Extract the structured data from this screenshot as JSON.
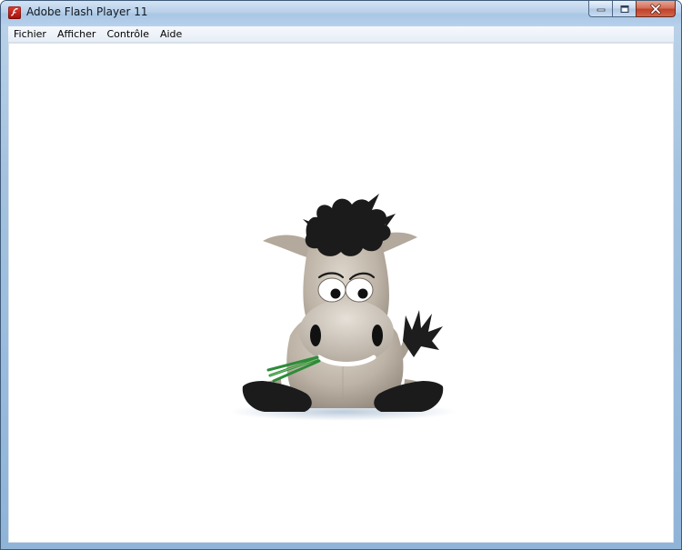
{
  "window": {
    "title": "Adobe Flash Player 11",
    "app_icon": "flash-player-icon",
    "caption_buttons": [
      "minimize-icon",
      "maximize-icon",
      "close-icon"
    ]
  },
  "menubar": {
    "items": [
      "Fichier",
      "Afficher",
      "Contrôle",
      "Aide"
    ]
  },
  "stage": {
    "content": "donkey-mascot"
  },
  "colors": {
    "title_gradient_top": "#d3e3f4",
    "title_gradient_bottom": "#b6d0ec",
    "close_button": "#c0422a",
    "stage_background": "#ffffff",
    "donkey_body": "#b9afa3",
    "donkey_hair": "#1c1c1c",
    "grass": "#2e8b3a"
  }
}
